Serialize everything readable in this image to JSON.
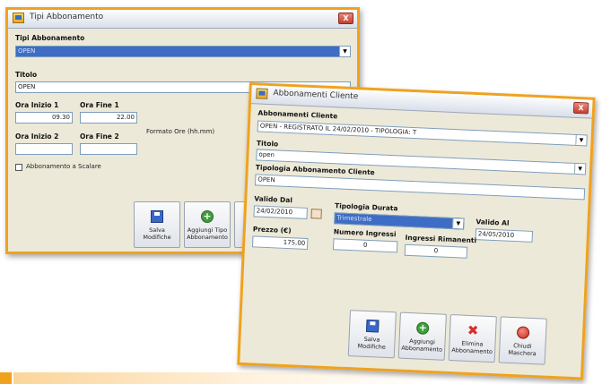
{
  "win1": {
    "title": "Tipi Abbonamento",
    "close": "X",
    "tipi_label": "Tipi Abbonamento",
    "tipi_value": "OPEN",
    "titolo_label": "Titolo",
    "titolo_value": "OPEN",
    "ora_inizio1_label": "Ora Inizio 1",
    "ora_inizio1_value": "09.30",
    "ora_fine1_label": "Ora Fine 1",
    "ora_fine1_value": "22.00",
    "formato_label": "Formato Ore (hh.mm)",
    "ora_inizio2_label": "Ora Inizio 2",
    "ora_fine2_label": "Ora Fine 2",
    "scalare_label": "Abbonamento a Scalare",
    "btn_salva": "Salva Modifiche",
    "btn_aggiungi": "Aggiungi Tipo Abbonamento",
    "btn_partial_a": "E",
    "btn_partial_b": "A"
  },
  "win2": {
    "title": "Abbonamenti Cliente",
    "close": "X",
    "abb_label": "Abbonamenti Cliente",
    "abb_value": "OPEN - REGISTRATO IL 24/02/2010 - TIPOLOGIA: T",
    "titolo_label": "Titolo",
    "titolo_value": "open",
    "tipologia_abb_label": "Tipologia Abbonamento Cliente",
    "tipologia_abb_value": "OPEN",
    "valido_dal_label": "Valido Dal",
    "valido_dal_value": "24/02/2010",
    "tipologia_durata_label": "Tipologia Durata",
    "tipologia_durata_value": "Trimestrale",
    "valido_al_label": "Valido Al",
    "valido_al_value": "24/05/2010",
    "prezzo_label": "Prezzo (€)",
    "prezzo_value": "175,00",
    "num_ingressi_label": "Numero Ingressi",
    "num_ingressi_value": "0",
    "ingressi_rim_label": "Ingressi Rimanenti",
    "ingressi_rim_value": "0",
    "btn_salva": "Salva Modifiche",
    "btn_aggiungi": "Aggiungi Abbonamento",
    "btn_elimina": "Elimina Abbonamento",
    "btn_chiudi": "Chiudi Maschera"
  },
  "colors": {
    "accent": "#f0a21e",
    "selection": "#3d6dc5"
  },
  "icons": [
    "window-icon",
    "save-icon",
    "add-icon",
    "delete-icon",
    "close-icon",
    "calendar-icon",
    "chevron-down-icon"
  ]
}
